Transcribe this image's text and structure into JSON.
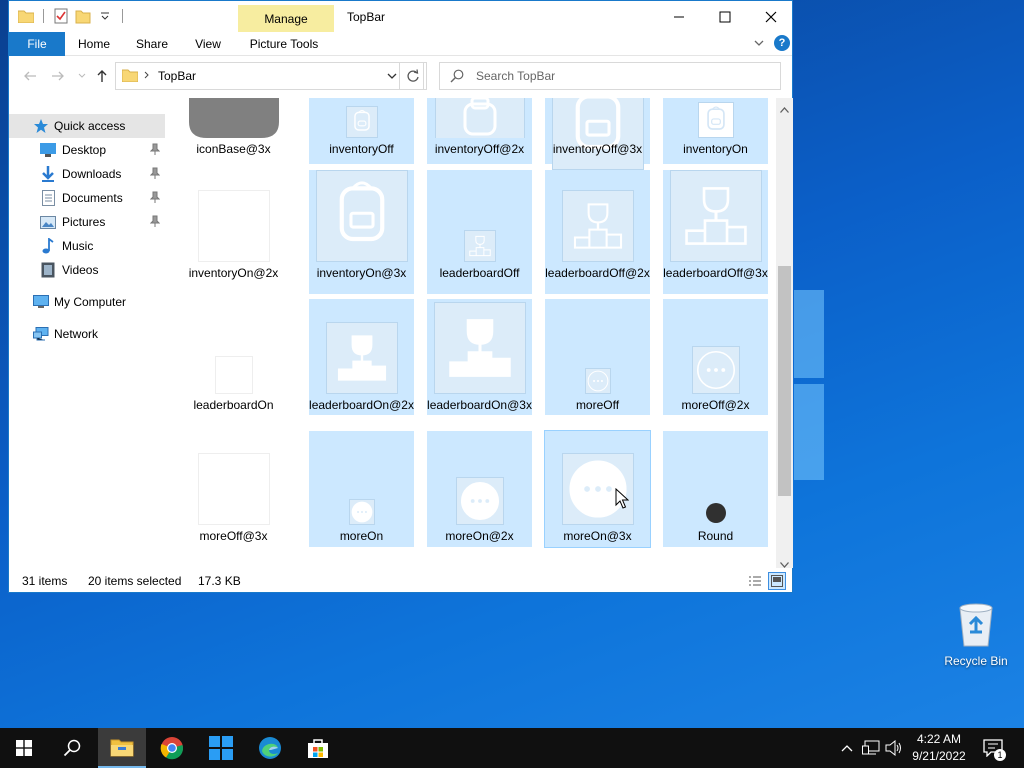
{
  "window": {
    "title": "TopBar",
    "manage_tab": "Manage",
    "ribbon_tabs": [
      "File",
      "Home",
      "Share",
      "View",
      "Picture Tools"
    ],
    "help": "?"
  },
  "address": {
    "path": "TopBar",
    "search_placeholder": "Search TopBar"
  },
  "nav_pane": {
    "quick_access": "Quick access",
    "items": [
      "Desktop",
      "Downloads",
      "Documents",
      "Pictures",
      "Music",
      "Videos"
    ],
    "my_computer": "My Computer",
    "network": "Network"
  },
  "files": [
    {
      "name": "iconBase@3x",
      "selected": false,
      "thumb": "gray-rounded"
    },
    {
      "name": "inventoryOff",
      "selected": true,
      "thumb": "backpack-small"
    },
    {
      "name": "inventoryOff@2x",
      "selected": true,
      "thumb": "backpack-med"
    },
    {
      "name": "inventoryOff@3x",
      "selected": true,
      "thumb": "backpack-large"
    },
    {
      "name": "inventoryOn",
      "selected": true,
      "thumb": "backpack-white-small"
    },
    {
      "name": "inventoryOn@2x",
      "selected": false,
      "thumb": "blank"
    },
    {
      "name": "inventoryOn@3x",
      "selected": true,
      "thumb": "backpack-large"
    },
    {
      "name": "leaderboardOff",
      "selected": true,
      "thumb": "trophy-small"
    },
    {
      "name": "leaderboardOff@2x",
      "selected": true,
      "thumb": "trophy-med"
    },
    {
      "name": "leaderboardOff@3x",
      "selected": true,
      "thumb": "trophy-large"
    },
    {
      "name": "leaderboardOn",
      "selected": false,
      "thumb": "blank-small"
    },
    {
      "name": "leaderboardOn@2x",
      "selected": true,
      "thumb": "trophy-white-med"
    },
    {
      "name": "leaderboardOn@3x",
      "selected": true,
      "thumb": "trophy-white-large"
    },
    {
      "name": "moreOff",
      "selected": true,
      "thumb": "more-small"
    },
    {
      "name": "moreOff@2x",
      "selected": true,
      "thumb": "more-med"
    },
    {
      "name": "moreOff@3x",
      "selected": false,
      "thumb": "blank"
    },
    {
      "name": "moreOn",
      "selected": true,
      "thumb": "more-white-small"
    },
    {
      "name": "moreOn@2x",
      "selected": true,
      "thumb": "more-white-med"
    },
    {
      "name": "moreOn@3x",
      "selected": true,
      "thumb": "more-white-large"
    },
    {
      "name": "Round",
      "selected": true,
      "thumb": "dark-dot"
    }
  ],
  "status": {
    "items": "31 items",
    "selected": "20 items selected",
    "size": "17.3 KB"
  },
  "desktop": {
    "recycle_bin": "Recycle Bin"
  },
  "taskbar": {
    "time": "4:22 AM",
    "date": "9/21/2022",
    "notification_count": "1"
  },
  "colors": {
    "accent": "#1979ca",
    "selection": "#cce8ff",
    "manage_tab": "#f7eda0"
  }
}
